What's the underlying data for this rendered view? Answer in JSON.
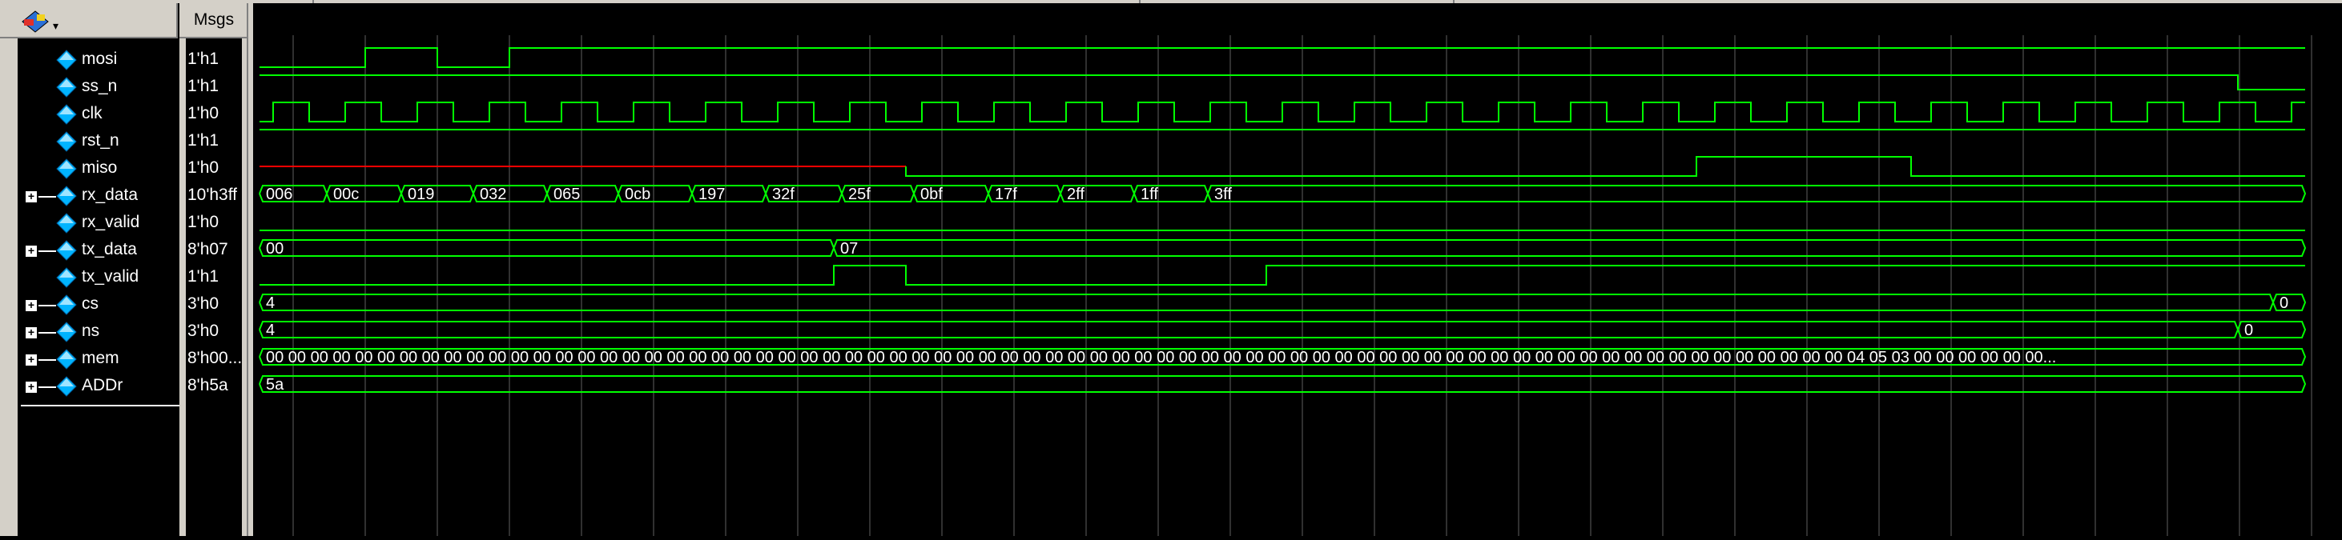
{
  "toolbar": {
    "logo_icon": "modelsim-wave-icon",
    "dropdown_icon": "chevron-down-icon"
  },
  "header": {
    "msgs_label": "Msgs"
  },
  "signals": [
    {
      "name": "mosi",
      "value": "1'h1",
      "expandable": false
    },
    {
      "name": "ss_n",
      "value": "1'h1",
      "expandable": false
    },
    {
      "name": "clk",
      "value": "1'h0",
      "expandable": false
    },
    {
      "name": "rst_n",
      "value": "1'h1",
      "expandable": false
    },
    {
      "name": "miso",
      "value": "1'h0",
      "expandable": false
    },
    {
      "name": "rx_data",
      "value": "10'h3ff",
      "expandable": true
    },
    {
      "name": "rx_valid",
      "value": "1'h0",
      "expandable": false
    },
    {
      "name": "tx_data",
      "value": "8'h07",
      "expandable": true
    },
    {
      "name": "tx_valid",
      "value": "1'h1",
      "expandable": false
    },
    {
      "name": "cs",
      "value": "3'h0",
      "expandable": true
    },
    {
      "name": "ns",
      "value": "3'h0",
      "expandable": true
    },
    {
      "name": "mem",
      "value": "8'h00...",
      "expandable": true
    },
    {
      "name": "ADDr",
      "value": "8'h5a",
      "expandable": true
    }
  ],
  "bus_labels": {
    "rx_data": [
      "006",
      "00c",
      "019",
      "032",
      "065",
      "0cb",
      "197",
      "32f",
      "25f",
      "0bf",
      "17f",
      "2ff",
      "1ff",
      "3ff"
    ],
    "tx_data": [
      "00",
      "07"
    ],
    "cs": [
      "4",
      "0"
    ],
    "ns": [
      "4",
      "0"
    ],
    "mem": [
      "00 00 00 00 00 00 00 00 00 00 00 00 00 00 00 00 00 00 00 00 00 00 00 00 00 00 00 00 00 00 00 00 00 00 00 00 00 00 00 00 00 00 00 00 00 00 00 00 00 00 00 00 00 00 00 00 00 00 00 00 00 00 00 00 00 00 00 00 00 00 00 04 05 03 00 00 00 00 00 00..."
    ],
    "ADDr": [
      "5a"
    ]
  },
  "colors": {
    "wave": "#00ff00",
    "undefined": "#ff0000",
    "grid": "#606060",
    "panel": "#d4d0c8",
    "diamond": "#00b4ff"
  }
}
